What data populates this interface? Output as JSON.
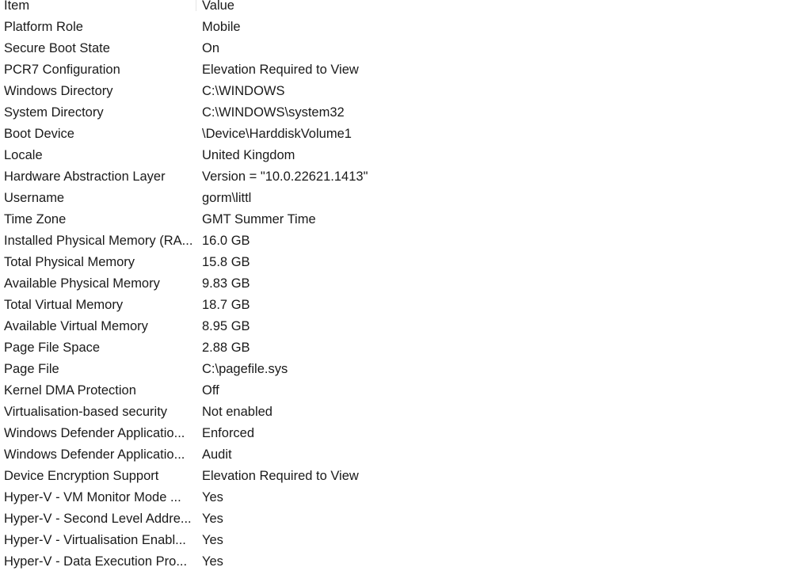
{
  "columns": {
    "item": "Item",
    "value": "Value"
  },
  "rows": [
    {
      "item": "Platform Role",
      "value": "Mobile"
    },
    {
      "item": "Secure Boot State",
      "value": "On"
    },
    {
      "item": "PCR7 Configuration",
      "value": "Elevation Required to View"
    },
    {
      "item": "Windows Directory",
      "value": "C:\\WINDOWS"
    },
    {
      "item": "System Directory",
      "value": "C:\\WINDOWS\\system32"
    },
    {
      "item": "Boot Device",
      "value": "\\Device\\HarddiskVolume1"
    },
    {
      "item": "Locale",
      "value": "United Kingdom"
    },
    {
      "item": "Hardware Abstraction Layer",
      "value": "Version = \"10.0.22621.1413\""
    },
    {
      "item": "Username",
      "value": "gorm\\littl"
    },
    {
      "item": "Time Zone",
      "value": "GMT Summer Time"
    },
    {
      "item": "Installed Physical Memory (RA...",
      "value": "16.0 GB"
    },
    {
      "item": "Total Physical Memory",
      "value": "15.8 GB"
    },
    {
      "item": "Available Physical Memory",
      "value": "9.83 GB"
    },
    {
      "item": "Total Virtual Memory",
      "value": "18.7 GB"
    },
    {
      "item": "Available Virtual Memory",
      "value": "8.95 GB"
    },
    {
      "item": "Page File Space",
      "value": "2.88 GB"
    },
    {
      "item": "Page File",
      "value": "C:\\pagefile.sys"
    },
    {
      "item": "Kernel DMA Protection",
      "value": "Off"
    },
    {
      "item": "Virtualisation-based security",
      "value": "Not enabled"
    },
    {
      "item": "Windows Defender Applicatio...",
      "value": "Enforced"
    },
    {
      "item": "Windows Defender Applicatio...",
      "value": "Audit"
    },
    {
      "item": "Device Encryption Support",
      "value": "Elevation Required to View"
    },
    {
      "item": "Hyper-V - VM Monitor Mode ...",
      "value": "Yes"
    },
    {
      "item": "Hyper-V - Second Level Addre...",
      "value": "Yes"
    },
    {
      "item": "Hyper-V - Virtualisation Enabl...",
      "value": "Yes"
    },
    {
      "item": "Hyper-V - Data Execution Pro...",
      "value": "Yes"
    }
  ]
}
